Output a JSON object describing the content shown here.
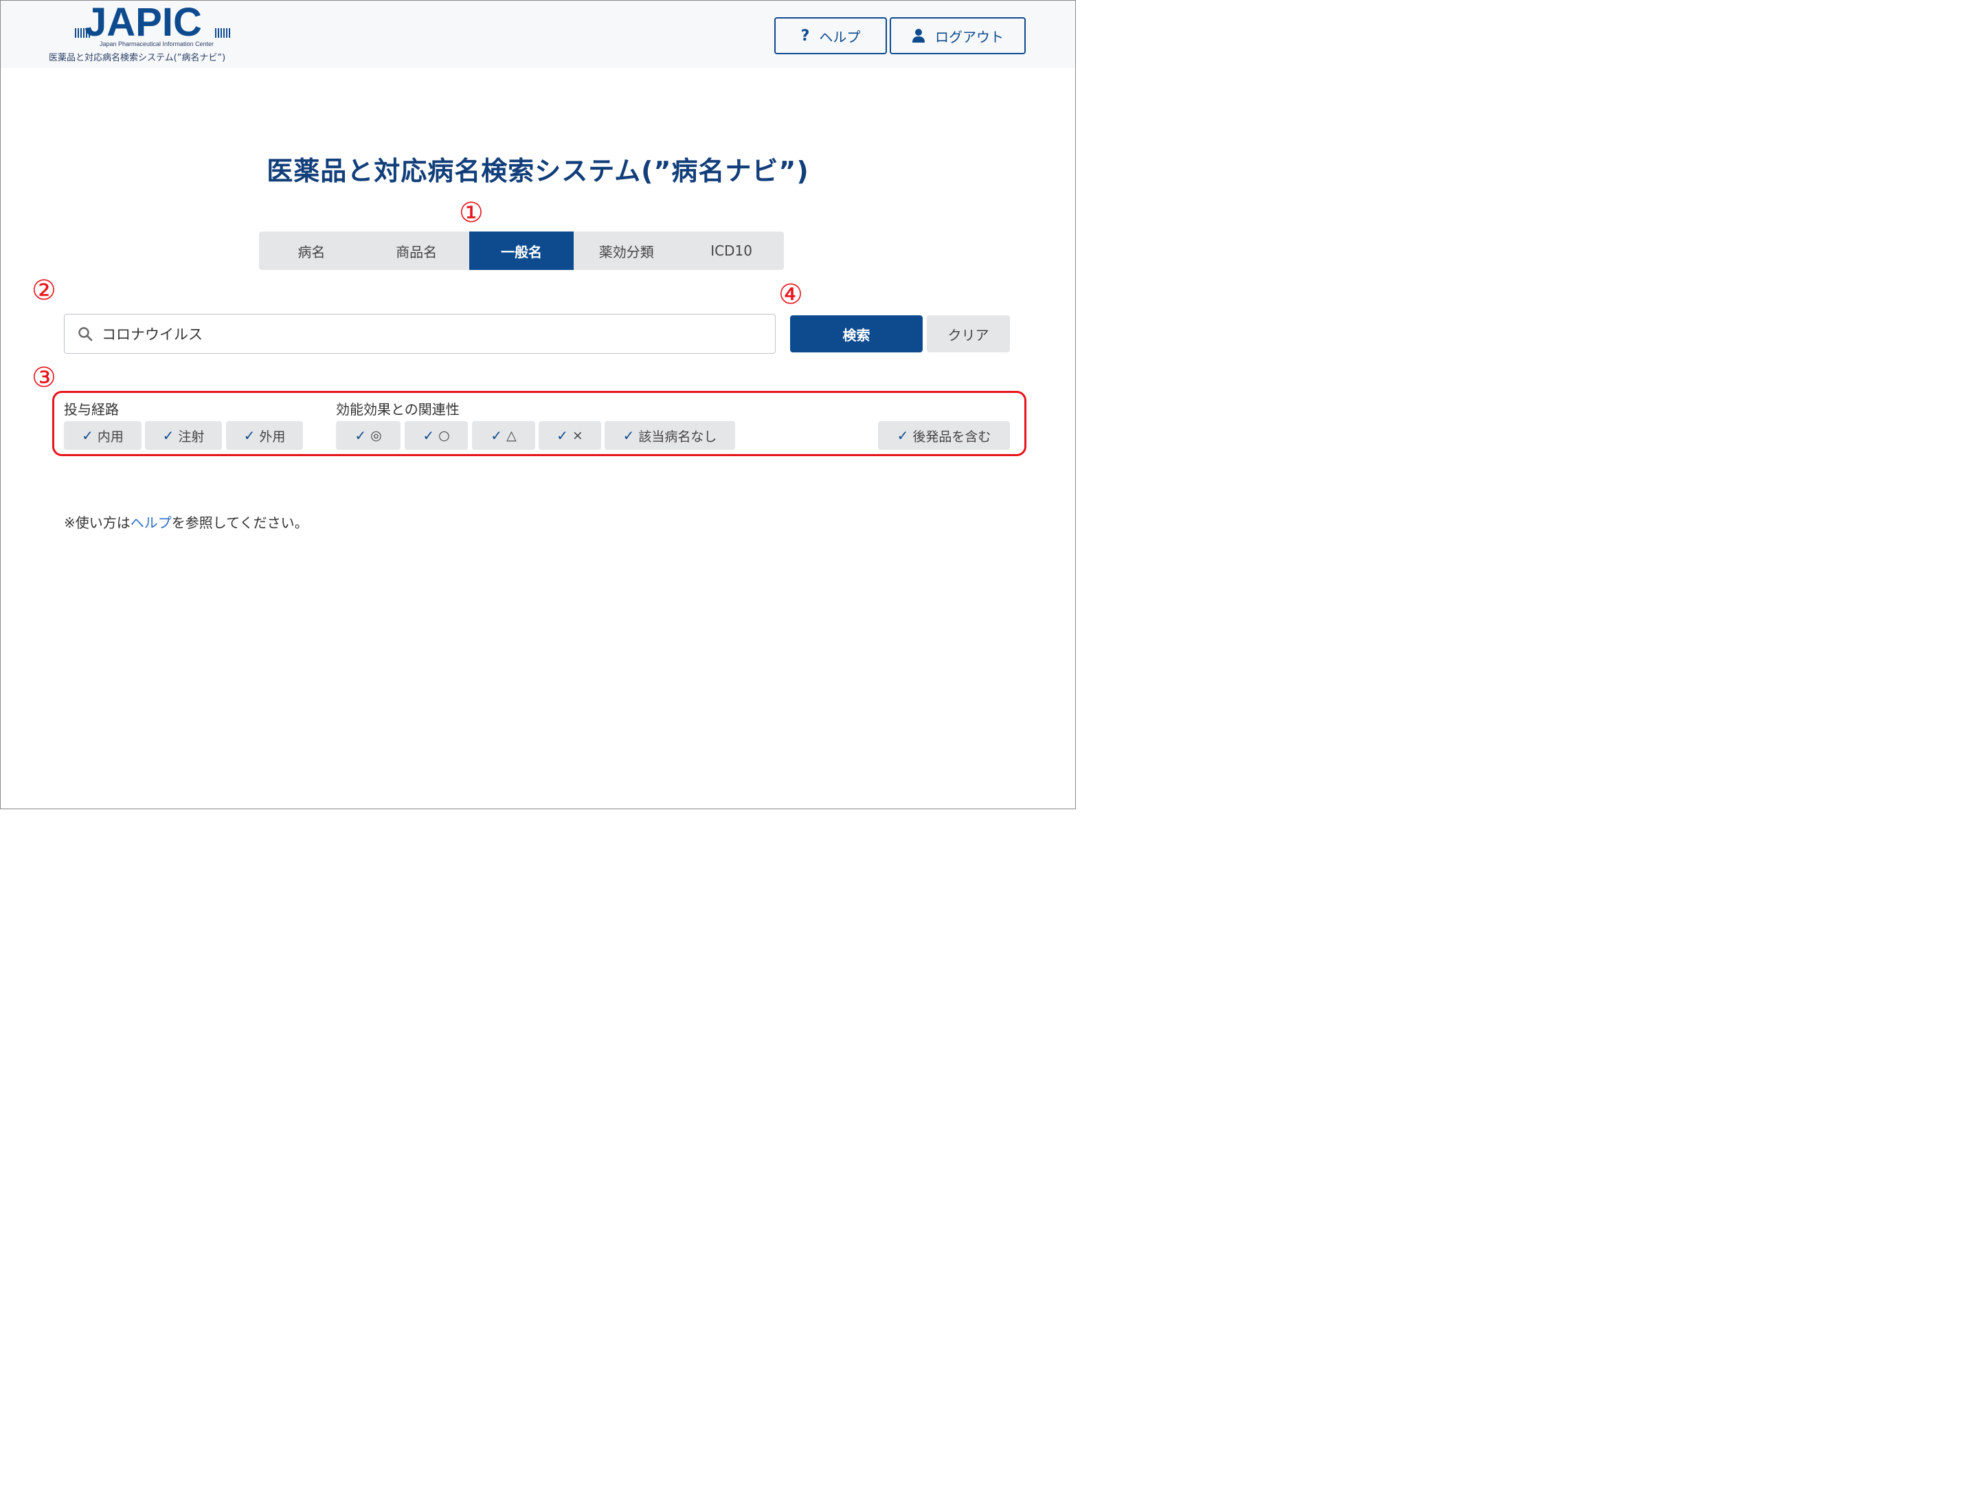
{
  "header": {
    "logo_text": "JAPIC",
    "logo_subtitle": "Japan Pharmaceutical Information Center",
    "system_name": "医薬品と対応病名検索システム(”病名ナビ”)",
    "help_label": "ヘルプ",
    "help_icon": "question-icon",
    "logout_label": "ログアウト",
    "logout_icon": "user-icon"
  },
  "page_title": "医薬品と対応病名検索システム(”病名ナビ”)",
  "markers": {
    "m1": "①",
    "m2": "②",
    "m3": "③",
    "m4": "④"
  },
  "tabs": [
    {
      "label": "病名",
      "active": false
    },
    {
      "label": "商品名",
      "active": false
    },
    {
      "label": "一般名",
      "active": true
    },
    {
      "label": "薬効分類",
      "active": false
    },
    {
      "label": "ICD10",
      "active": false
    }
  ],
  "search": {
    "value": "コロナウイルス",
    "button_label": "検索",
    "clear_label": "クリア"
  },
  "filters": {
    "route_label": "投与経路",
    "route_chips": [
      "内用",
      "注射",
      "外用"
    ],
    "relevance_label": "効能効果との関連性",
    "relevance_chips": [
      "◎",
      "○",
      "△",
      "×",
      "該当病名なし"
    ],
    "generic_chip": "後発品を含む",
    "check_mark": "✓"
  },
  "note": {
    "prefix": "※使い方は",
    "link": "ヘルプ",
    "suffix": "を参照してください。"
  },
  "colors": {
    "brand": "#0d4b8e",
    "annotation_red": "#e8131b",
    "chip_bg": "#e5e6e8"
  }
}
